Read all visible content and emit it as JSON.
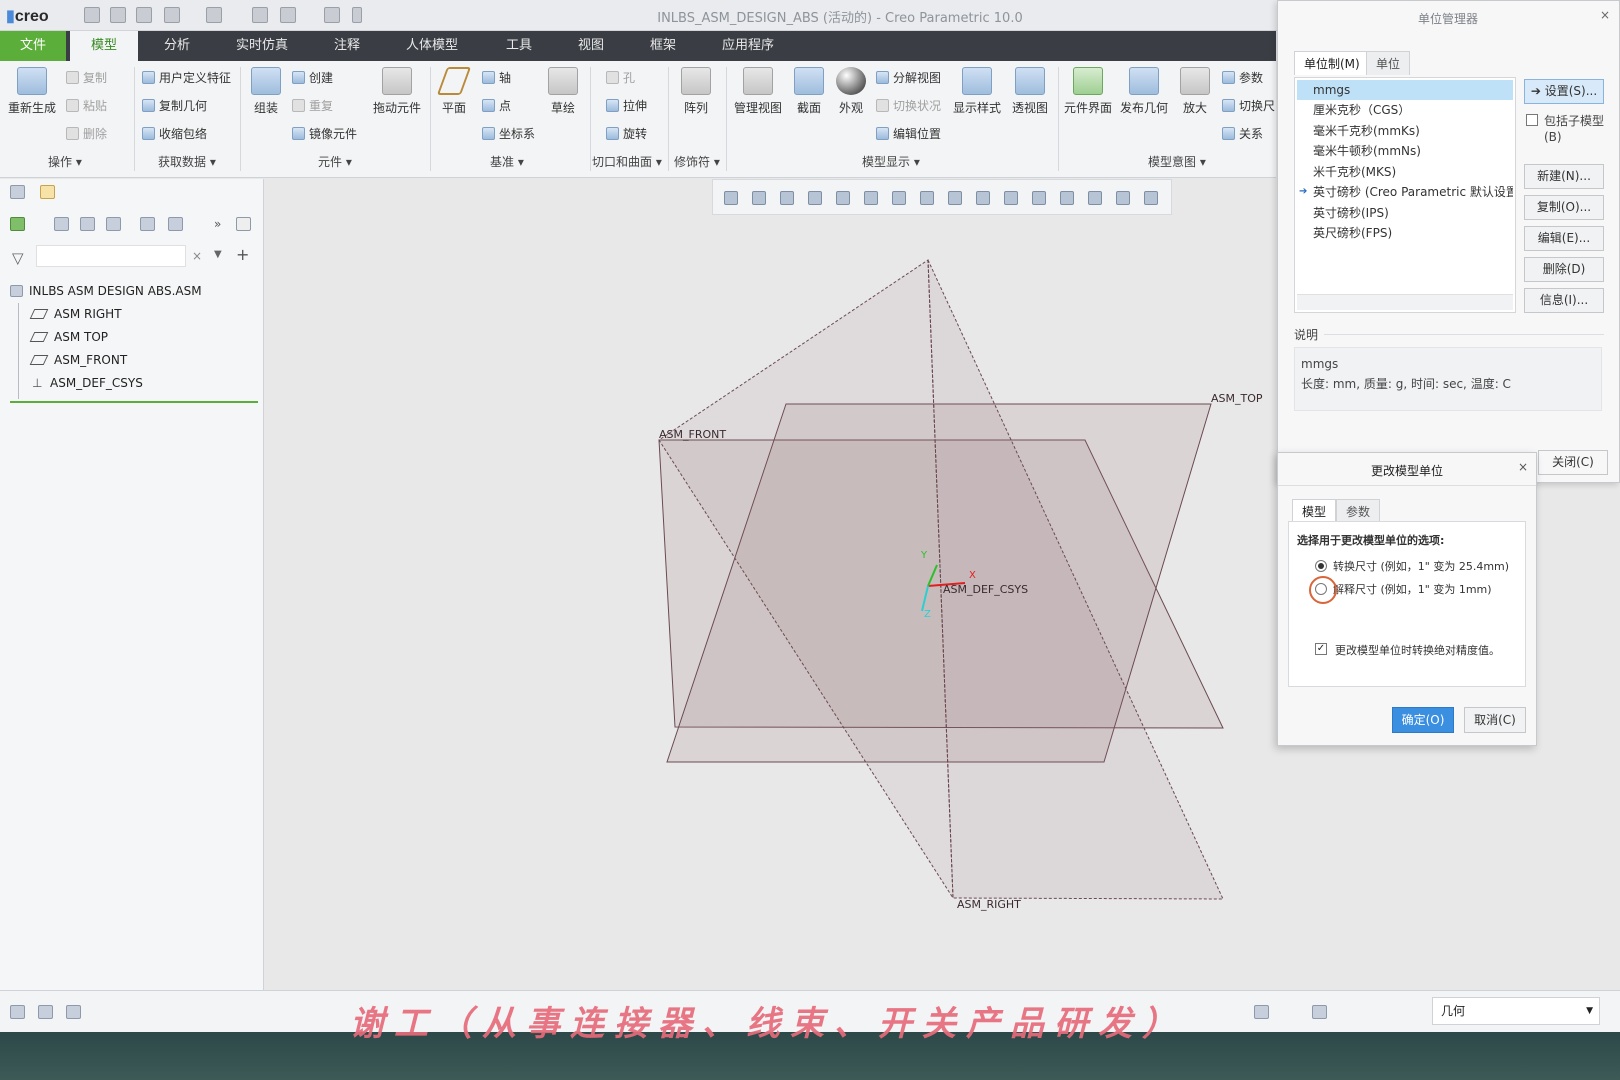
{
  "app": {
    "logo": "creo",
    "window_title": "INLBS_ASM_DESIGN_ABS (活动的) - Creo Parametric 10.0"
  },
  "menus": [
    "文件",
    "模型",
    "分析",
    "实时仿真",
    "注释",
    "人体模型",
    "工具",
    "视图",
    "框架",
    "应用程序"
  ],
  "active_menu": "模型",
  "ribbon": {
    "regenerate": "重新生成",
    "copy": "复制",
    "paste": "粘贴",
    "delete": "删除",
    "user_feature": "用户定义特征",
    "copy_geometry": "复制几何",
    "shrinkwrap": "收缩包络",
    "assemble": "组装",
    "create": "创建",
    "repeat": "重复",
    "mirror_component": "镜像元件",
    "drag_components": "拖动元件",
    "plane": "平面",
    "axis": "轴",
    "point": "点",
    "csys": "坐标系",
    "sketch": "草绘",
    "hole": "孔",
    "extrude": "拉伸",
    "revolve": "旋转",
    "pattern": "阵列",
    "manage_views": "管理视图",
    "section": "截面",
    "appearance": "外观",
    "explode_view": "分解视图",
    "toggle_status": "切换状况",
    "edit_position": "编辑位置",
    "display_style": "显示样式",
    "perspective": "透视图",
    "component_interface": "元件界面",
    "publish_geometry": "发布几何",
    "bill_of_materials": "放大",
    "parameters": "参数",
    "switch_dims": "切换尺",
    "relations": "关系",
    "groups": [
      "操作",
      "获取数据",
      "元件",
      "基准",
      "切口和曲面",
      "修饰符",
      "模型显示",
      "模型意图"
    ]
  },
  "model_tree": {
    "root": "INLBS ASM DESIGN ABS.ASM",
    "items": [
      "ASM RIGHT",
      "ASM TOP",
      "ASM_FRONT",
      "ASM_DEF_CSYS"
    ]
  },
  "graphics": {
    "labels": {
      "top": "ASM_TOP",
      "front": "ASM_FRONT",
      "right": "ASM_RIGHT",
      "csys": "ASM_DEF_CSYS",
      "x": "X",
      "y": "Y",
      "z": "Z"
    }
  },
  "unit_manager": {
    "title": "单位管理器",
    "tabs": [
      "单位制(M)",
      "单位"
    ],
    "systems": [
      "mmgs",
      "厘米克秒（CGS）",
      "毫米千克秒(mmKs)",
      "毫米牛顿秒(mmNs)",
      "米千克秒(MKS)",
      "英寸磅秒 (Creo Parametric 默认设置)",
      "英寸磅秒(IPS)",
      "英尺磅秒(FPS)"
    ],
    "selected_index": 0,
    "buttons": {
      "set": "设置(S)...",
      "include_sub": "包括子模型(B)",
      "new": "新建(N)...",
      "copy": "复制(O)...",
      "edit": "编辑(E)...",
      "delete": "删除(D)",
      "info": "信息(I)...",
      "close": "关闭(C)"
    },
    "desc_label": "说明",
    "desc_line1": "mmgs",
    "desc_line2": "长度: mm, 质量: g, 时间: sec, 温度: C"
  },
  "change_units": {
    "title": "更改模型单位",
    "tabs": [
      "模型",
      "参数"
    ],
    "prompt": "选择用于更改模型单位的选项:",
    "option1": "转换尺寸 (例如，1\" 变为 25.4mm)",
    "option2": "解释尺寸 (例如，1\" 变为 1mm)",
    "checkbox": "更改模型单位时转换绝对精度值。",
    "ok": "确定(O)",
    "cancel": "取消(C)"
  },
  "status": {
    "filter": "几何"
  },
  "watermark": "谢工（从事连接器、线束、开关产品研发）"
}
